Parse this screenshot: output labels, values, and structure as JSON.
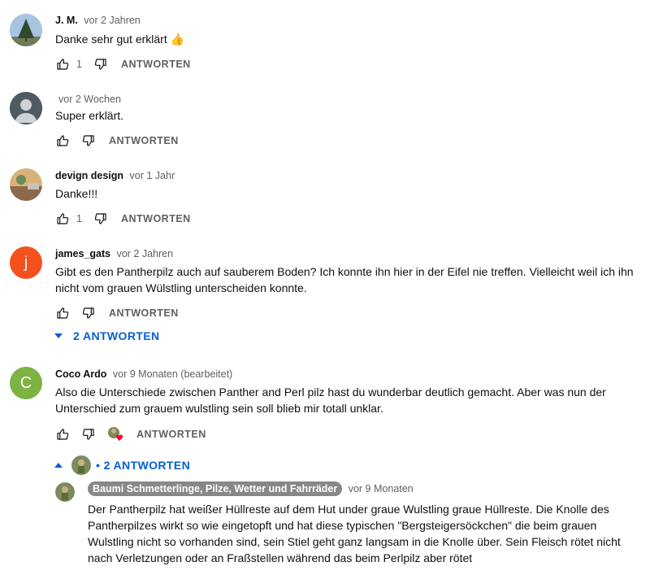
{
  "comments": [
    {
      "author": "J. M.",
      "time": "vor 2 Jahren",
      "text": "Danke sehr gut erklärt 👍",
      "likes": "1",
      "reply": "ANTWORTEN"
    },
    {
      "author": "",
      "time": "vor 2 Wochen",
      "text": "Super erklärt.",
      "likes": "",
      "reply": "ANTWORTEN"
    },
    {
      "author": "devign design",
      "time": "vor 1 Jahr",
      "text": "Danke!!!",
      "likes": "1",
      "reply": "ANTWORTEN"
    },
    {
      "author": "james_gats",
      "time": "vor 2 Jahren",
      "avatar_letter": "j",
      "text": "Gibt es den Pantherpilz auch auf sauberem Boden? Ich konnte ihn hier in der Eifel nie treffen. Vielleicht weil ich ihn nicht vom grauen Wülstling unterscheiden konnte.",
      "likes": "",
      "reply": "ANTWORTEN",
      "replies_toggle": "2 ANTWORTEN"
    },
    {
      "author": "Coco Ardo",
      "time": "vor 9 Monaten (bearbeitet)",
      "avatar_letter": "C",
      "text": "Also die Unterschiede zwischen Panther and Perl pilz hast du wunderbar deutlich gemacht. Aber was nun der Unterschied zum grauem wulstling sein soll blieb mir totall unklar.",
      "likes": "",
      "reply": "ANTWORTEN",
      "replies_toggle": "• 2 ANTWORTEN"
    }
  ],
  "reply": {
    "author": "Baumi Schmetterlinge, Pilze, Wetter und Fahrräder",
    "time": "vor 9 Monaten",
    "text": "Der Pantherpilz hat weißer Hüllreste auf dem Hut under graue Wulstling graue Hüllreste. Die Knolle des Pantherpilzes wirkt so wie eingetopft und hat diese typischen \"Bergsteigersöckchen\" die beim grauen Wulstling nicht so vorhanden sind, sein Stiel geht ganz langsam in die Knolle über. Sein Fleisch rötet nicht nach Verletzungen oder an Fraßstellen während das beim Perlpilz aber rötet"
  },
  "colors": {
    "accent": "#065fd4",
    "avatar_j": "#f4511e",
    "avatar_c": "#7cb342",
    "avatar_default": "#4f5b62",
    "heart": "#ff0033"
  },
  "icons": [
    "like-icon",
    "dislike-icon",
    "chevron-down-icon",
    "chevron-up-icon",
    "heart-icon"
  ]
}
